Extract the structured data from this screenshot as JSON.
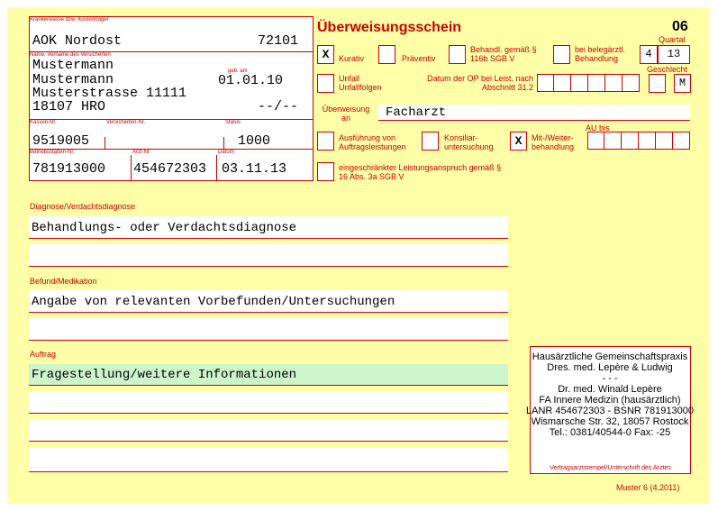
{
  "form": {
    "title": "Überweisungsschein",
    "form_number": "06",
    "footer": "Muster 6 (4.2011)"
  },
  "patient": {
    "insurer_label": "Krankenkasse bzw. Kostenträger",
    "insurer": "AOK Nordost",
    "insurer_code": "72101",
    "name_label": "Name, Vorname des Versicherten",
    "last_name": "Mustermann",
    "first_name": "Mustermann",
    "birth_label": "geb. am",
    "birth_date": "01.01.10",
    "street": "Musterstrasse 11111",
    "city": "18107 HRO",
    "extra": "--/--",
    "kassen_nr_label": "Kassen-Nr.",
    "versicherten_nr_label": "Versicherten-Nr.",
    "status_label": "Status",
    "kassen_nr": "9519005",
    "status": "1000",
    "betrieb_label": "Betriebsstätten-Nr.",
    "arzt_label": "Arzt-Nr.",
    "datum_label": "Datum",
    "betriebsstaette_nr": "781913000",
    "arzt_nr": "454672303",
    "datum": "03.11.13"
  },
  "options": {
    "kurativ": {
      "label": "Kurativ",
      "mark": "X"
    },
    "praeventiv": {
      "label": "Präventiv",
      "mark": ""
    },
    "behandl_116b": {
      "label": "Behandl. gemäß § 116b SGB V",
      "mark": ""
    },
    "belegaerztl": {
      "label": "bei belegärztl. Behandlung",
      "mark": ""
    },
    "unfall": {
      "label": "Unfall Unfallfolgen",
      "mark": ""
    },
    "op_label": "Datum der OP bei Leist. nach Abschnitt 31.2",
    "ausfuehrung": {
      "label": "Ausführung von Auftragsleistungen",
      "mark": ""
    },
    "konsiliar": {
      "label": "Konsiliar- untersuchung",
      "mark": ""
    },
    "mitbehandlung": {
      "label": "Mit-/Weiter- behandlung",
      "mark": "X"
    },
    "eingeschraenkt": {
      "label": "eingeschränkter Leistungsanspruch gemäß § 16 Abs. 3a SGB V",
      "mark": ""
    }
  },
  "quartal": {
    "label": "Quartal",
    "digit1": "4",
    "digit2": "13"
  },
  "geschlecht": {
    "label": "Geschlecht",
    "value": "M"
  },
  "ueberweisung": {
    "label": "Überweisung an",
    "value": "Facharzt"
  },
  "au_bis_label": "AU bis",
  "sections": {
    "diagnose_label": "Diagnose/Verdachtsdiagnose",
    "diagnose": "Behandlungs- oder Verdachtsdiagnose",
    "befund_label": "Befund/Medikation",
    "befund": "Angabe von relevanten Vorbefunden/Untersuchungen",
    "auftrag_label": "Auftrag",
    "auftrag": "Fragestellung/weitere Informationen"
  },
  "stamp": {
    "line1": "Hausärztliche Gemeinschaftspraxis",
    "line2": "Dres. med. Lepère & Ludwig",
    "line3": "- - -",
    "line4": "Dr. med. Winald Lepère",
    "line5": "FA Innere Medizin (hausärztlich)",
    "line6": "LANR 454672303 - BSNR 781913000",
    "line7": "Wismarsche Str. 32, 18057 Rostock",
    "line8": "Tel.: 0381/40544-0 Fax: -25",
    "caption": "Vertragsarztstempel/Unterschrift des Arztes"
  }
}
